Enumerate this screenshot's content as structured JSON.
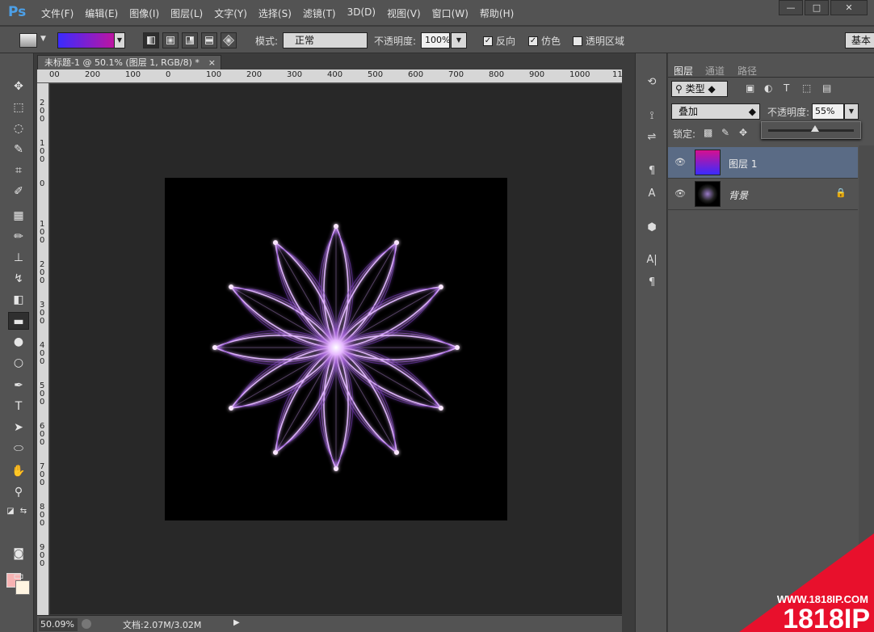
{
  "app": {
    "logo": "Ps",
    "menus": [
      "文件(F)",
      "编辑(E)",
      "图像(I)",
      "图层(L)",
      "文字(Y)",
      "选择(S)",
      "滤镜(T)",
      "3D(D)",
      "视图(V)",
      "窗口(W)",
      "帮助(H)"
    ],
    "window_controls": [
      "—",
      "□",
      "✕"
    ]
  },
  "options": {
    "mode_label": "模式:",
    "mode_value": "正常",
    "opacity_label": "不透明度:",
    "opacity_value": "100%",
    "reverse_label": "反向",
    "dither_label": "仿色",
    "transparency_label": "透明区域",
    "workspace_label": "基本",
    "gradient_colors": [
      "#3a2bff",
      "#d61090"
    ]
  },
  "document": {
    "tab_title": "未标题-1 @ 50.1% (图层 1, RGB/8) *",
    "tab_close": "×",
    "ruler_h": [
      "00",
      "200",
      "100",
      "0",
      "100",
      "200",
      "300",
      "400",
      "500",
      "600",
      "700",
      "800",
      "900",
      "1000",
      "11"
    ],
    "ruler_v": [
      "2",
      "0",
      "0",
      "1",
      "0",
      "0",
      "0",
      "1",
      "0",
      "0",
      "2",
      "0",
      "0",
      "3",
      "0",
      "0",
      "4",
      "0",
      "0",
      "5",
      "0",
      "0",
      "6",
      "0",
      "0",
      "7",
      "0",
      "0",
      "8",
      "0",
      "0",
      "9",
      "0",
      "0"
    ],
    "zoom": "50.09%",
    "doc_info": "文档:2.07M/3.02M"
  },
  "layers_panel": {
    "tabs": [
      "图层",
      "通道",
      "路径"
    ],
    "filter_value": "类型",
    "blend_mode": "叠加",
    "opacity_label": "不透明度:",
    "opacity_value": "55%",
    "opacity_fraction": 0.55,
    "lock_label": "锁定:",
    "layers": [
      {
        "name": "图层 1",
        "selected": true
      },
      {
        "name": "背景",
        "locked": true
      }
    ]
  },
  "watermark": {
    "url": "WWW.1818IP.COM",
    "brand": "1818IP"
  },
  "colors": {
    "foreground": "#f7b3b3",
    "background": "#fff5e2",
    "accent": "#e8102c",
    "flower": "#b46cf0"
  },
  "tools": [
    "move-icon",
    "marquee-icon",
    "lasso-icon",
    "quick-select-icon",
    "crop-icon",
    "eyedropper-icon",
    "healing-icon",
    "brush-icon",
    "stamp-icon",
    "history-brush-icon",
    "eraser-icon",
    "gradient-icon",
    "blur-icon",
    "dodge-icon",
    "pen-icon",
    "type-icon",
    "path-select-icon",
    "ellipse-icon",
    "hand-icon",
    "zoom-icon"
  ]
}
